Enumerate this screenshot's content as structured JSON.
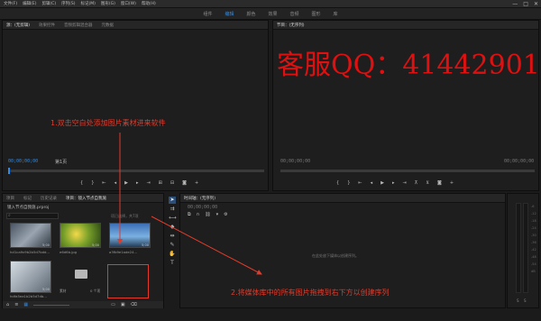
{
  "menu": [
    "文件(F)",
    "编辑(E)",
    "剪辑(C)",
    "序列(S)",
    "标记(M)",
    "图形(G)",
    "窗口(W)",
    "帮助(H)"
  ],
  "window_controls": [
    "—",
    "□",
    "✕"
  ],
  "workspaces": [
    {
      "label": "组件",
      "active": false
    },
    {
      "label": "编辑",
      "active": true
    },
    {
      "label": "颜色",
      "active": false
    },
    {
      "label": "效果",
      "active": false
    },
    {
      "label": "音频",
      "active": false
    },
    {
      "label": "图形",
      "active": false
    },
    {
      "label": "库",
      "active": false
    }
  ],
  "source_panel": {
    "tabs": [
      "源：(无剪辑)",
      "效果控件",
      "音频剪辑混合器",
      "元数据"
    ],
    "timecode": "00;00;00;00",
    "page": "第1页"
  },
  "program_panel": {
    "tab": "节目：(无序列)",
    "timecode_left": "00;00;00;00",
    "timecode_right": "00;00;00;00",
    "watermark": "客服QQ：41442901"
  },
  "annotations": {
    "step1": "1.双击空白处添加图片素材进来软件",
    "step2": "2.将媒体库中的所有图片拖拽到右下方以创建序列"
  },
  "project_panel": {
    "tabs": [
      "项目",
      "标记",
      "历史记录",
      "项目：镜入节点自我施"
    ],
    "project_file": "镜入节点自我施.prproj",
    "search_placeholder": "",
    "selected_info": "项已选择，共7项",
    "items": [
      {
        "label": "hd1ca9v9b2b5d7bdd...",
        "duration": "5;00"
      },
      {
        "label": "e6d6b.jpg",
        "duration": "5;00"
      },
      {
        "label": "a3fb9e1ade24...",
        "duration": "5;00"
      },
      {
        "label": "hdfa5ea1b2b5d7db...",
        "duration": "5;00"
      },
      {
        "label": "素材",
        "duration": ""
      },
      {
        "label": "0 个项",
        "duration": ""
      }
    ]
  },
  "timeline_panel": {
    "tab": "时间轴：(无序列)",
    "timecode": "00;00;00;00",
    "empty_message": "在此处放下媒体以创建序列。"
  },
  "tools": [
    "arrow-icon",
    "track-select-icon",
    "ripple-icon",
    "razor-icon",
    "slip-icon",
    "pen-icon",
    "hand-icon",
    "type-icon"
  ],
  "colors": {
    "accent": "#2d8ceb",
    "annotation_red": "#e23b2b"
  }
}
